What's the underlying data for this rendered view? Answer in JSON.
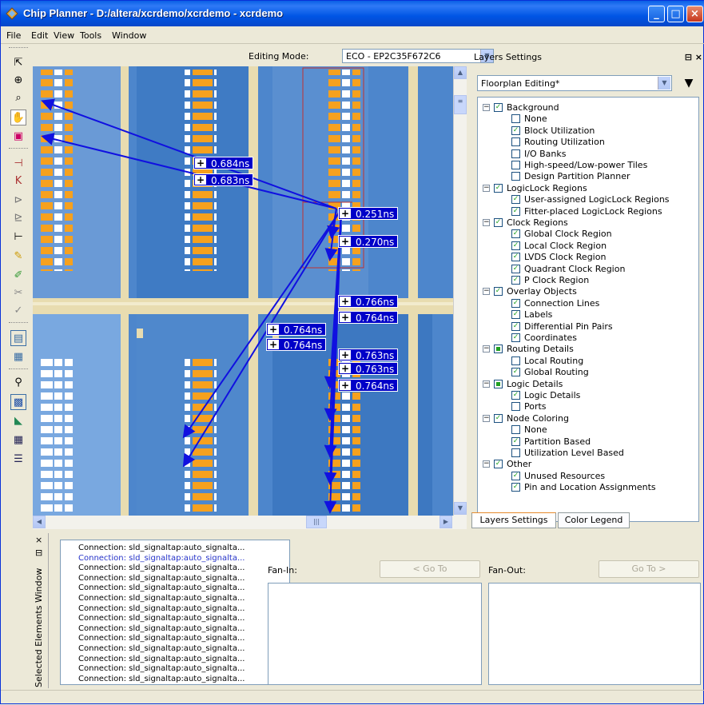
{
  "window": {
    "title": "Chip Planner - D:/altera/xcrdemo/xcrdemo - xcrdemo"
  },
  "menu": [
    "File",
    "Edit",
    "View",
    "Tools",
    "Window"
  ],
  "editing_mode": {
    "label": "Editing Mode:",
    "value": "ECO - EP2C35F672C6"
  },
  "delays": [
    {
      "value": "0.684ns"
    },
    {
      "value": "0.683ns"
    },
    {
      "value": "0.251ns"
    },
    {
      "value": "0.270ns"
    },
    {
      "value": "0.766ns"
    },
    {
      "value": "0.764ns"
    },
    {
      "value": "0.764ns"
    },
    {
      "value": "0.764ns"
    },
    {
      "value": "0.763ns"
    },
    {
      "value": "0.763ns"
    },
    {
      "value": "0.764ns"
    }
  ],
  "layers": {
    "title": "Layers Settings",
    "preset": "Floorplan Editing*",
    "tree": [
      {
        "label": "Background",
        "level": 0,
        "state": "checked",
        "expander": "−"
      },
      {
        "label": "None",
        "level": 1,
        "state": "unchecked"
      },
      {
        "label": "Block Utilization",
        "level": 1,
        "state": "checked"
      },
      {
        "label": "Routing Utilization",
        "level": 1,
        "state": "unchecked"
      },
      {
        "label": "I/O Banks",
        "level": 1,
        "state": "unchecked"
      },
      {
        "label": "High-speed/Low-power Tiles",
        "level": 1,
        "state": "unchecked"
      },
      {
        "label": "Design Partition Planner",
        "level": 1,
        "state": "unchecked"
      },
      {
        "label": "LogicLock Regions",
        "level": 0,
        "state": "checked",
        "expander": "−"
      },
      {
        "label": "User-assigned LogicLock Regions",
        "level": 1,
        "state": "checked"
      },
      {
        "label": "Fitter-placed LogicLock Regions",
        "level": 1,
        "state": "checked"
      },
      {
        "label": "Clock Regions",
        "level": 0,
        "state": "checked",
        "expander": "−"
      },
      {
        "label": "Global Clock Region",
        "level": 1,
        "state": "checked"
      },
      {
        "label": "Local Clock Region",
        "level": 1,
        "state": "checked"
      },
      {
        "label": "LVDS Clock Region",
        "level": 1,
        "state": "checked"
      },
      {
        "label": "Quadrant Clock Region",
        "level": 1,
        "state": "checked"
      },
      {
        "label": "P Clock Region",
        "level": 1,
        "state": "checked"
      },
      {
        "label": "Overlay Objects",
        "level": 0,
        "state": "checked",
        "expander": "−"
      },
      {
        "label": "Connection Lines",
        "level": 1,
        "state": "checked"
      },
      {
        "label": "Labels",
        "level": 1,
        "state": "checked"
      },
      {
        "label": "Differential Pin Pairs",
        "level": 1,
        "state": "checked"
      },
      {
        "label": "Coordinates",
        "level": 1,
        "state": "checked"
      },
      {
        "label": "Routing Details",
        "level": 0,
        "state": "partial",
        "expander": "−"
      },
      {
        "label": "Local Routing",
        "level": 1,
        "state": "unchecked"
      },
      {
        "label": "Global Routing",
        "level": 1,
        "state": "checked"
      },
      {
        "label": "Logic Details",
        "level": 0,
        "state": "partial",
        "expander": "−"
      },
      {
        "label": "Logic Details",
        "level": 1,
        "state": "checked"
      },
      {
        "label": "Ports",
        "level": 1,
        "state": "unchecked"
      },
      {
        "label": "Node Coloring",
        "level": 0,
        "state": "checked",
        "expander": "−"
      },
      {
        "label": "None",
        "level": 1,
        "state": "unchecked"
      },
      {
        "label": "Partition Based",
        "level": 1,
        "state": "checked"
      },
      {
        "label": "Utilization Level Based",
        "level": 1,
        "state": "unchecked"
      },
      {
        "label": "Other",
        "level": 0,
        "state": "checked",
        "expander": "−"
      },
      {
        "label": "Unused Resources",
        "level": 1,
        "state": "checked"
      },
      {
        "label": "Pin and Location Assignments",
        "level": 1,
        "state": "checked"
      }
    ]
  },
  "tabs": [
    "Layers Settings",
    "Color Legend"
  ],
  "selected_elements": {
    "title": "Selected Elements Window",
    "connections": [
      {
        "text": "Connection: sld_signaltap:auto_signalta...",
        "highlight": false
      },
      {
        "text": "Connection: sld_signaltap:auto_signalta...",
        "highlight": true
      },
      {
        "text": "Connection: sld_signaltap:auto_signalta...",
        "highlight": false
      },
      {
        "text": "Connection: sld_signaltap:auto_signalta...",
        "highlight": false
      },
      {
        "text": "Connection: sld_signaltap:auto_signalta...",
        "highlight": false
      },
      {
        "text": "Connection: sld_signaltap:auto_signalta...",
        "highlight": false
      },
      {
        "text": "Connection: sld_signaltap:auto_signalta...",
        "highlight": false
      },
      {
        "text": "Connection: sld_signaltap:auto_signalta...",
        "highlight": false
      },
      {
        "text": "Connection: sld_signaltap:auto_signalta...",
        "highlight": false
      },
      {
        "text": "Connection: sld_signaltap:auto_signalta...",
        "highlight": false
      },
      {
        "text": "Connection: sld_signaltap:auto_signalta...",
        "highlight": false
      },
      {
        "text": "Connection: sld_signaltap:auto_signalta...",
        "highlight": false
      },
      {
        "text": "Connection: sld_signaltap:auto_signalta...",
        "highlight": false
      },
      {
        "text": "Connection: sld_signaltap:auto_signalta...",
        "highlight": false
      }
    ],
    "fan_in": "Fan-In:",
    "fan_out": "Fan-Out:",
    "goto_in": "< Go To",
    "goto_out": "Go To >"
  },
  "colors": {
    "accent": "#0000c8",
    "lab_orange": "#f6a11e",
    "die_blue": "#5087c8",
    "channel": "#e8dcb0"
  },
  "icons": [
    "select-icon",
    "zoom-icon",
    "zoom-region-icon",
    "hand-icon",
    "region-icon",
    "pin-icon",
    "connection-icon",
    "fanin-icon",
    "fanout-icon",
    "delay-icon",
    "pencil-icon",
    "paint-icon",
    "cut-icon",
    "check-icon",
    "report-icon",
    "net-icon",
    "find-icon",
    "grid-icon",
    "map-icon",
    "table-icon",
    "list-icon"
  ]
}
